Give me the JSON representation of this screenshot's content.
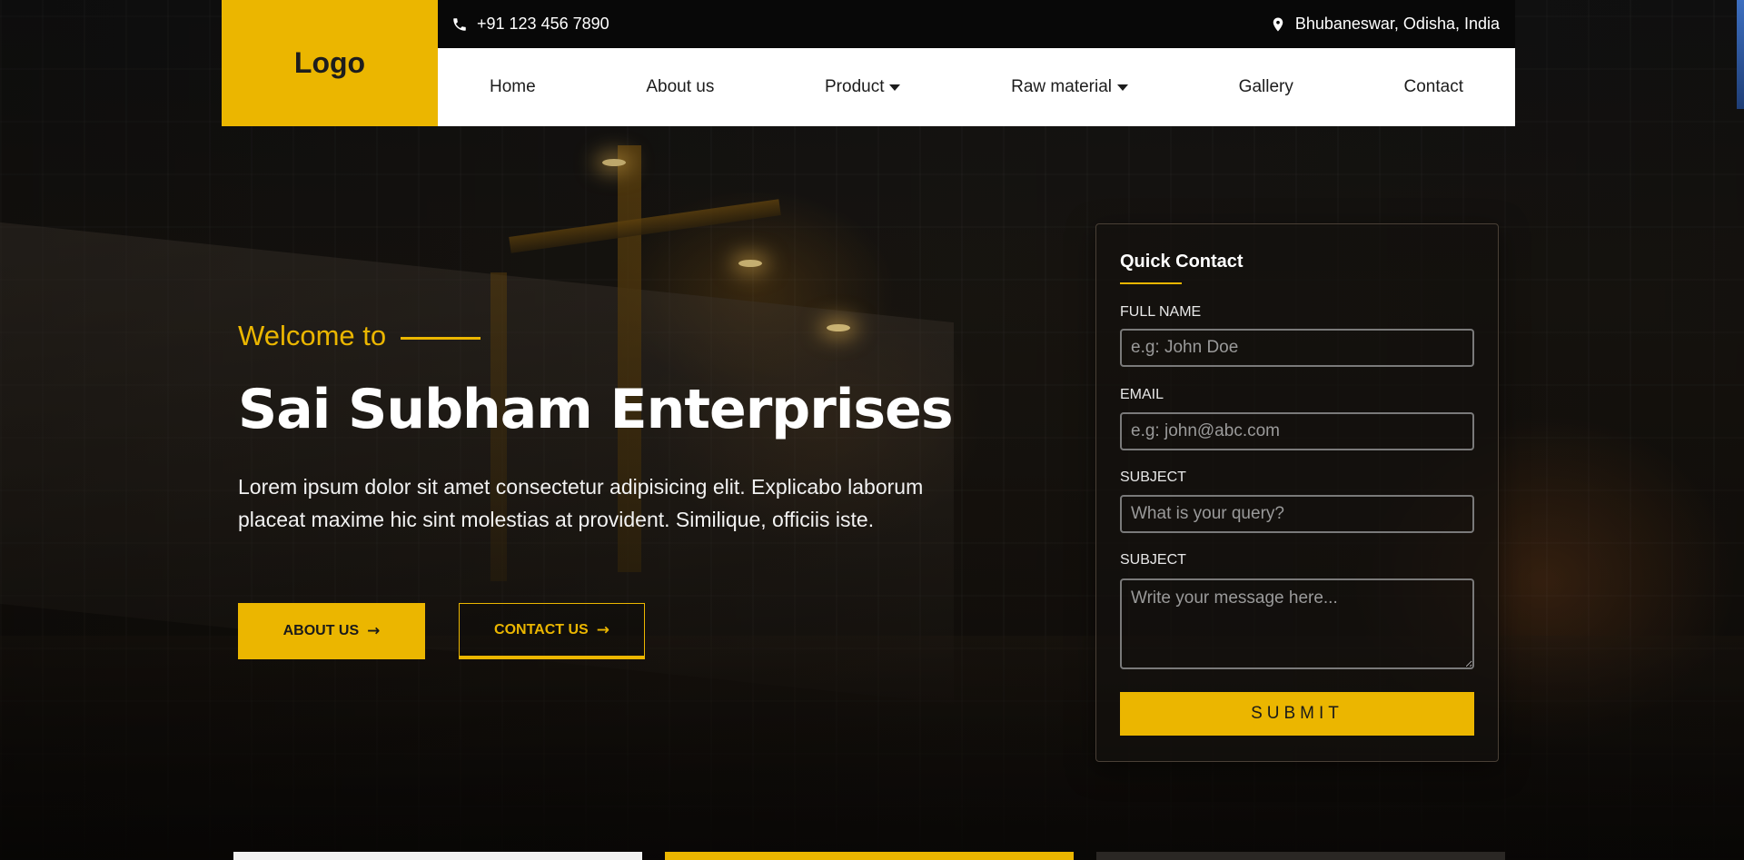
{
  "brand": {
    "logo": "Logo",
    "accent": "#ebb600"
  },
  "topbar": {
    "phone": "+91 123 456 7890",
    "phone_icon": "phone-icon",
    "location": "Bhubaneswar, Odisha, India",
    "location_icon": "map-pin-icon"
  },
  "nav": {
    "items": [
      {
        "label": "Home"
      },
      {
        "label": "About us"
      },
      {
        "label": "Product"
      },
      {
        "label": "Raw material"
      },
      {
        "label": "Gallery"
      },
      {
        "label": "Contact"
      }
    ]
  },
  "hero": {
    "welcome": "Welcome to",
    "title": "Sai Subham Enterprises",
    "description": "Lorem ipsum dolor sit amet consectetur adipisicing elit. Explicabo laborum placeat maxime hic sint molestias at provident. Similique, officiis iste.",
    "about_button": "ABOUT US",
    "contact_button": "CONTACT US"
  },
  "quick_contact": {
    "title": "Quick Contact",
    "fields": [
      {
        "label": "FULL NAME",
        "placeholder": "e.g: John Doe"
      },
      {
        "label": "EMAIL",
        "placeholder": "e.g: john@abc.com"
      },
      {
        "label": "SUBJECT",
        "placeholder": "What is your query?"
      },
      {
        "label": "SUBJECT",
        "placeholder": "Write your message here..."
      }
    ],
    "submit": "SUBMIT"
  }
}
